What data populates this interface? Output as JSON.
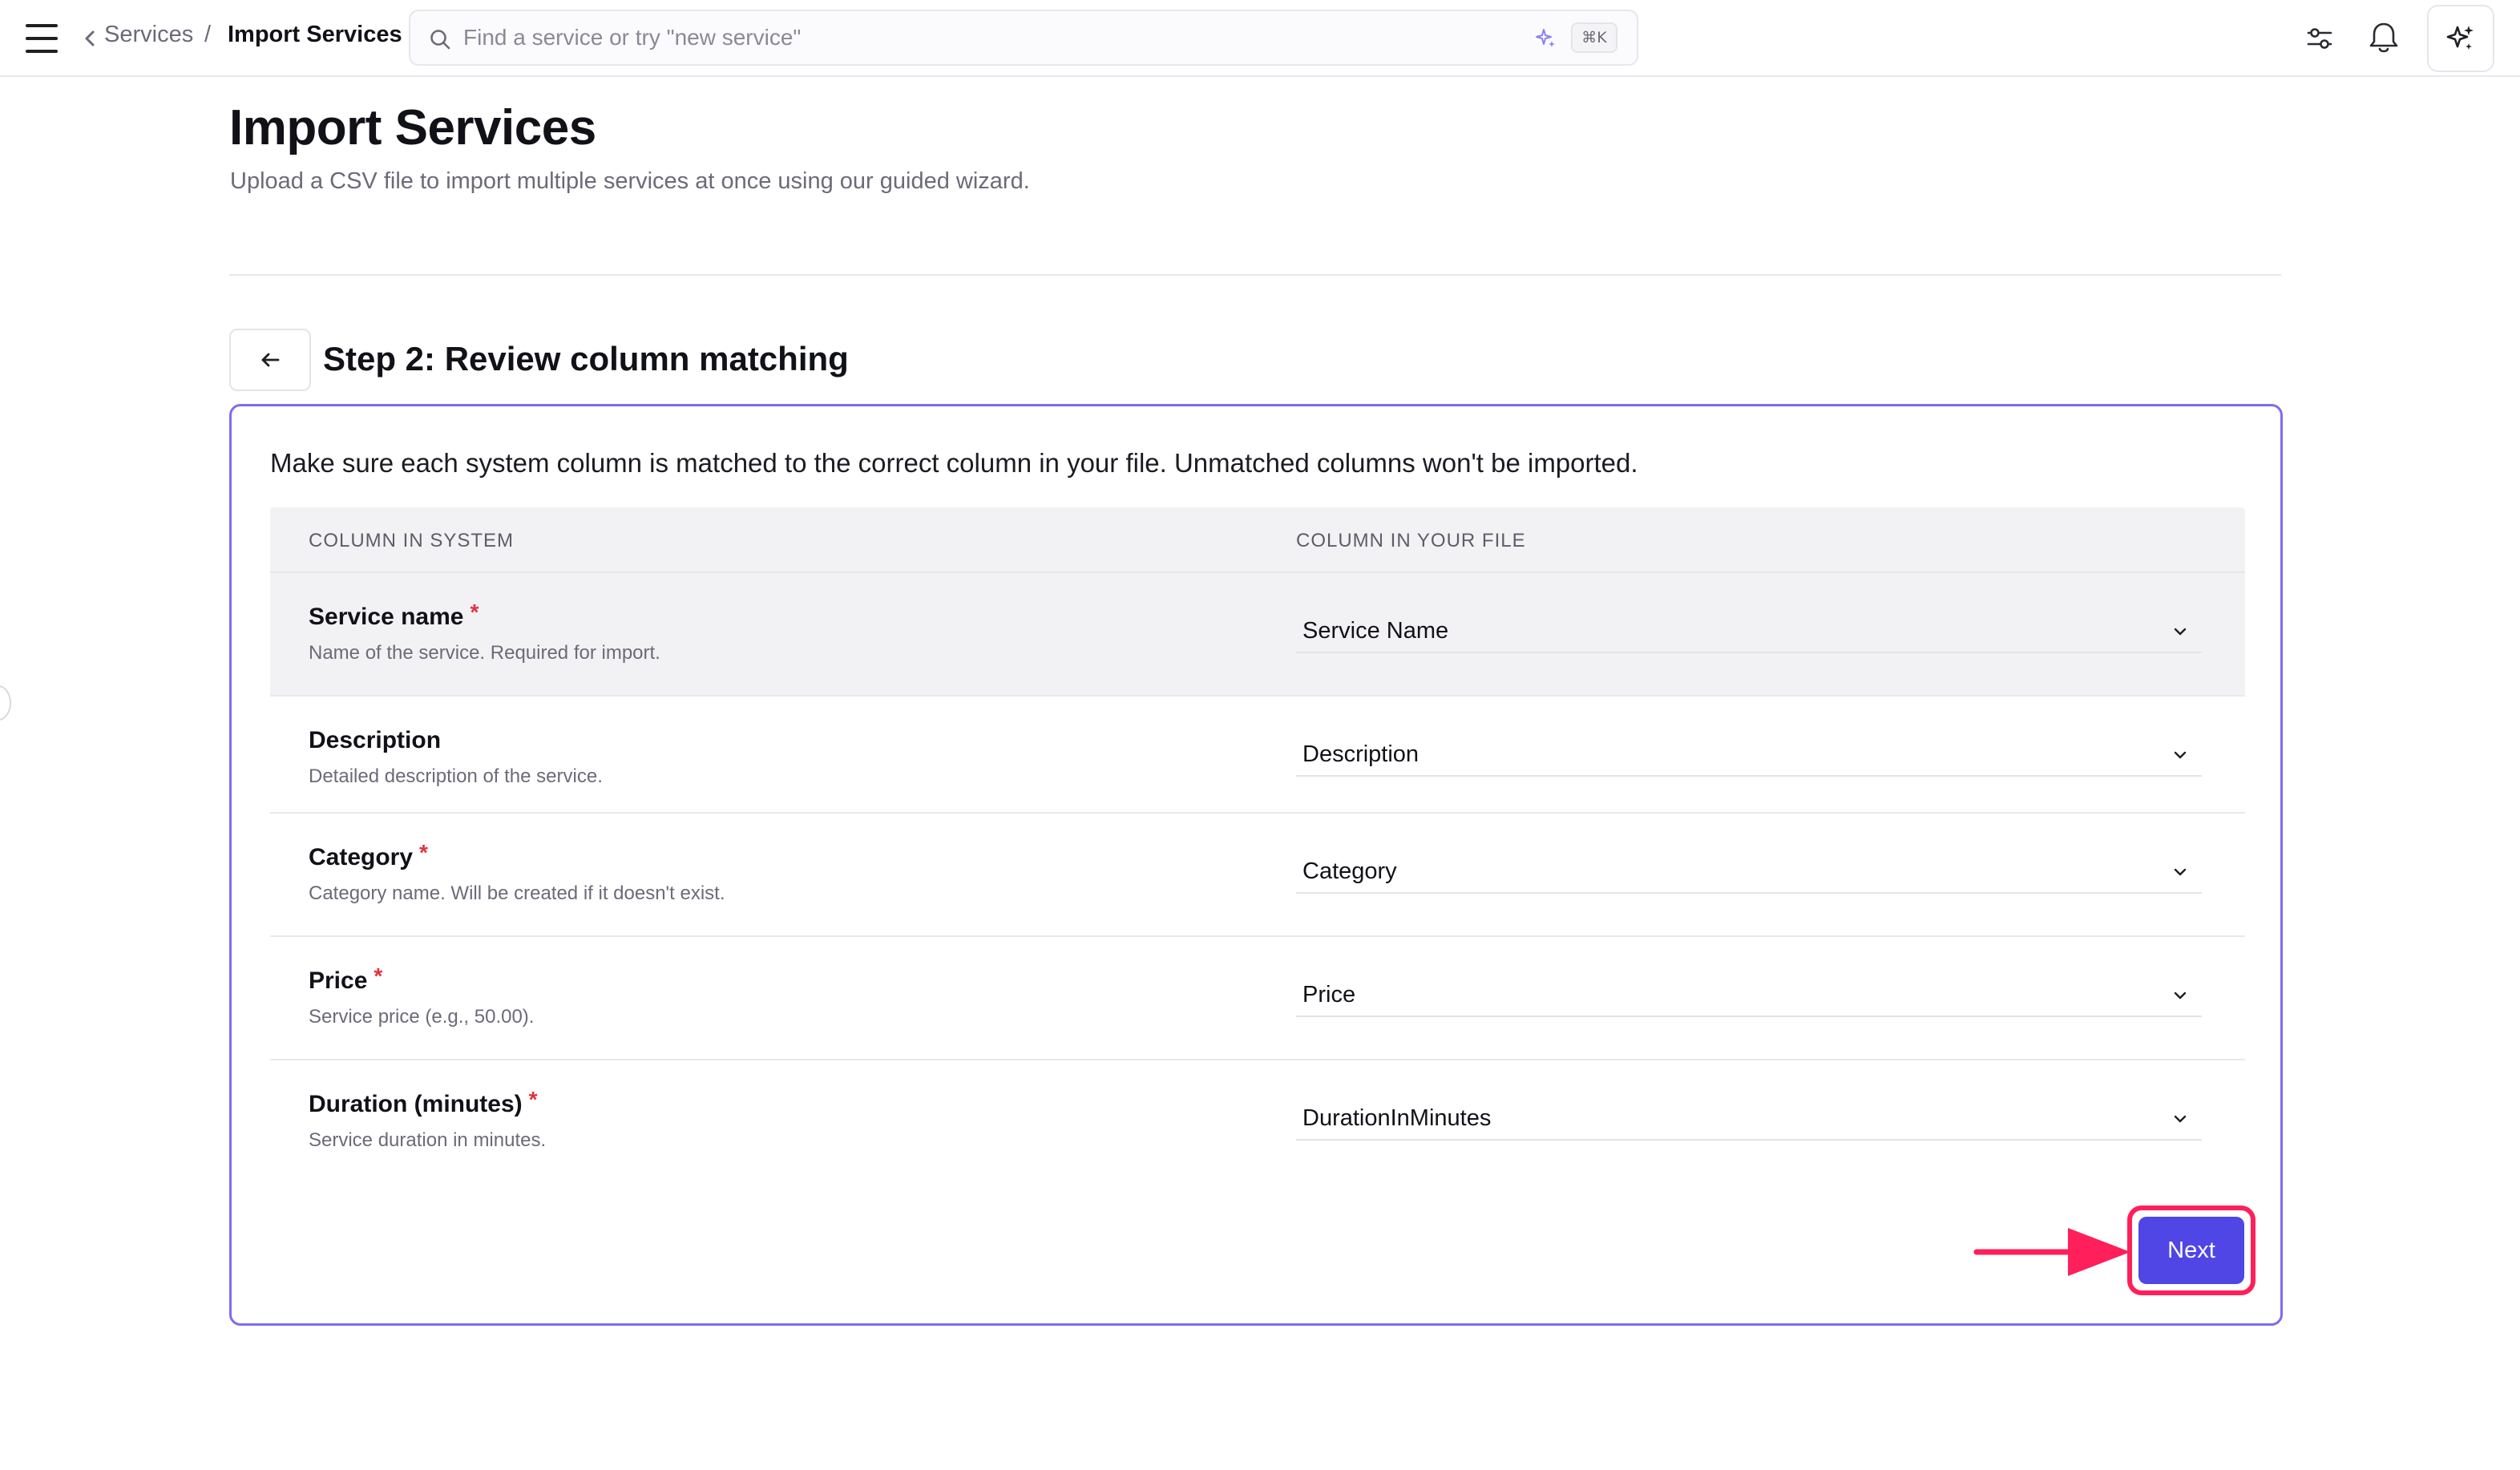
{
  "topbar": {
    "breadcrumb_parent": "Services",
    "breadcrumb_separator": "/",
    "breadcrumb_current": "Import Services",
    "search_placeholder": "Find a service or try \"new service\"",
    "search_shortcut": "⌘K",
    "icons": [
      "menu-icon",
      "chevron-left-icon",
      "search-icon",
      "sparkle-icon",
      "filter-icon",
      "bell-icon",
      "ai-sparkle-icon"
    ]
  },
  "page": {
    "title": "Import Services",
    "subtitle": "Upload a CSV file to import multiple services at once using our guided wizard."
  },
  "step": {
    "title": "Step 2: Review column matching",
    "back_icon": "arrow-left-icon"
  },
  "card": {
    "intro": "Make sure each system column is matched to the correct column in your file. Unmatched columns won't be imported.",
    "headers": {
      "system": "COLUMN IN SYSTEM",
      "file": "COLUMN IN YOUR FILE"
    },
    "required_marker": "*",
    "rows": [
      {
        "title": "Service name",
        "required": true,
        "description": "Name of the service. Required for import.",
        "selected": "Service Name"
      },
      {
        "title": "Description",
        "required": false,
        "description": "Detailed description of the service.",
        "selected": "Description"
      },
      {
        "title": "Category",
        "required": true,
        "description": "Category name. Will be created if it doesn't exist.",
        "selected": "Category"
      },
      {
        "title": "Price",
        "required": true,
        "description": "Service price (e.g., 50.00).",
        "selected": "Price"
      },
      {
        "title": "Duration (minutes)",
        "required": true,
        "description": "Service duration in minutes.",
        "selected": "DurationInMinutes"
      }
    ],
    "next_label": "Next"
  },
  "colors": {
    "accent": "#4f46e5",
    "card_border": "#7d6cf0",
    "annotation": "#ff1f5a",
    "required": "#e0333e"
  }
}
